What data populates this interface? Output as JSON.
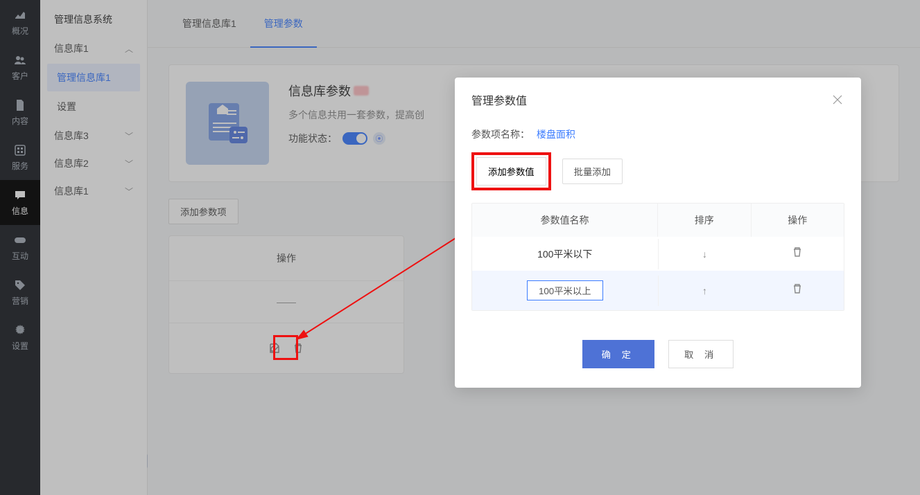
{
  "nav": [
    {
      "icon": "overview",
      "label": "概况"
    },
    {
      "icon": "users",
      "label": "客户"
    },
    {
      "icon": "file",
      "label": "内容"
    },
    {
      "icon": "service",
      "label": "服务"
    },
    {
      "icon": "chat",
      "label": "信息",
      "active": true
    },
    {
      "icon": "game",
      "label": "互动"
    },
    {
      "icon": "tag",
      "label": "营销"
    },
    {
      "icon": "gear",
      "label": "设置"
    }
  ],
  "sidebar": {
    "title": "管理信息系统",
    "groups": [
      {
        "label": "信息库1",
        "expanded": true,
        "items": [
          {
            "label": "管理信息库1",
            "selected": true
          },
          {
            "label": "设置"
          }
        ]
      },
      {
        "label": "信息库3",
        "expanded": false
      },
      {
        "label": "信息库2",
        "expanded": false
      },
      {
        "label": "信息库1",
        "expanded": false
      }
    ]
  },
  "tabs": [
    {
      "label": "管理信息库1"
    },
    {
      "label": "管理参数",
      "active": true
    }
  ],
  "card": {
    "title": "信息库参数",
    "desc": "多个信息共用一套参数，提高创",
    "state_label": "功能状态：",
    "enabled": true
  },
  "add_param_btn": "添加参数项",
  "param_table": {
    "head": "操作",
    "empty": "——"
  },
  "modal": {
    "title": "管理参数值",
    "meta_label": "参数项名称：",
    "meta_value": "楼盘面积",
    "add_value_btn": "添加参数值",
    "bulk_add_btn": "批量添加",
    "columns": {
      "name": "参数值名称",
      "sort": "排序",
      "ops": "操作"
    },
    "rows": [
      {
        "name": "100平米以下",
        "dir": "down",
        "editing": false
      },
      {
        "name": "100平米以上",
        "dir": "up",
        "editing": true
      }
    ],
    "ok": "确 定",
    "cancel": "取 消"
  }
}
